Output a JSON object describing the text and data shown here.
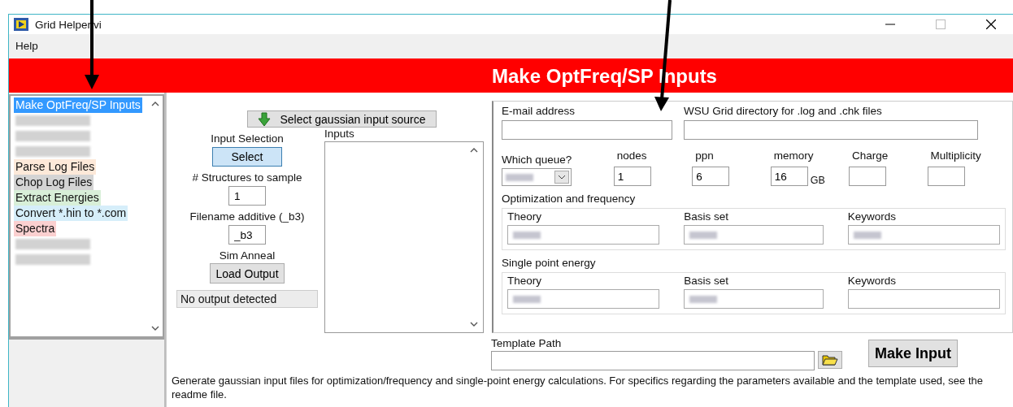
{
  "window": {
    "title": "Grid Helper.vi"
  },
  "menu": [
    "Help"
  ],
  "banner": "Make OptFreq/SP Inputs",
  "sidebar": {
    "items": [
      {
        "kind": "text",
        "label": "Make OptFreq/SP Inputs",
        "selected": true,
        "color": "#3399ff"
      },
      {
        "kind": "blurred",
        "selected": false
      },
      {
        "kind": "blurred",
        "selected": false
      },
      {
        "kind": "blurred",
        "selected": false
      },
      {
        "kind": "text",
        "label": "Parse Log Files",
        "selected": false,
        "color": "#fde9d9"
      },
      {
        "kind": "text",
        "label": "Chop Log Files",
        "selected": false,
        "color": "#d4d4d4"
      },
      {
        "kind": "text",
        "label": "Extract Energies",
        "selected": false,
        "color": "#d8efd8"
      },
      {
        "kind": "text",
        "label": "Convert *.hin to *.com",
        "selected": false,
        "color": "#d6eefa"
      },
      {
        "kind": "text",
        "label": "Spectra",
        "selected": false,
        "color": "#fbd0d0"
      },
      {
        "kind": "blurred",
        "selected": false
      },
      {
        "kind": "blurred",
        "selected": false
      }
    ]
  },
  "source_button": "Select gaussian input source",
  "input_selection": {
    "label": "Input Selection",
    "button": "Select"
  },
  "structures": {
    "label": "# Structures to sample",
    "value": "1"
  },
  "filename_additive": {
    "label": "Filename additive (_b3)",
    "value": "_b3"
  },
  "sim_anneal": {
    "label": "Sim Anneal",
    "button": "Load Output"
  },
  "status": "No output detected",
  "inputs": {
    "label": "Inputs"
  },
  "email": {
    "label": "E-mail address"
  },
  "directory": {
    "label": "WSU Grid directory for .log and .chk files"
  },
  "queue": {
    "label": "Which queue?",
    "redacted": true
  },
  "params": [
    {
      "label": "nodes",
      "value": "1"
    },
    {
      "label": "ppn",
      "value": "6"
    },
    {
      "label": "memory",
      "value": "16",
      "unit": "GB"
    },
    {
      "label": "Charge"
    },
    {
      "label": "Multiplicity"
    }
  ],
  "groups": [
    {
      "title": "Optimization and frequency",
      "fields": [
        {
          "label": "Theory",
          "redacted": true
        },
        {
          "label": "Basis set",
          "redacted": true
        },
        {
          "label": "Keywords",
          "redacted": true
        }
      ]
    },
    {
      "title": "Single point energy",
      "fields": [
        {
          "label": "Theory",
          "redacted": true
        },
        {
          "label": "Basis set",
          "redacted": true
        },
        {
          "label": "Keywords",
          "redacted": false
        }
      ]
    }
  ],
  "template_path": {
    "label": "Template Path"
  },
  "make_button": "Make Input",
  "description": "Generate gaussian input files for optimization/frequency and single-point energy calculations. For specifics regarding the parameters available and the template used, see the readme file."
}
